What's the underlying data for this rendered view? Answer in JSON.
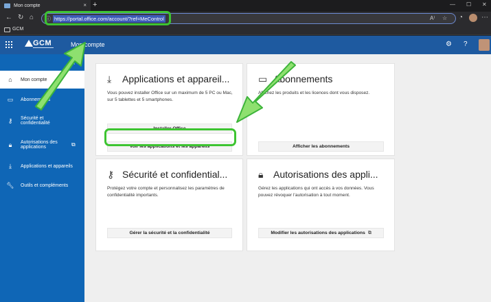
{
  "browser": {
    "tab_title": "Mon compte",
    "tab_close": "×",
    "new_tab": "+",
    "url": "https://portal.office.com/account/?ref=MeControl",
    "bookmark_label": "GCM"
  },
  "app": {
    "brand": "GCM",
    "title": "Mon compte"
  },
  "sidebar": {
    "items": [
      {
        "label": "Mon compte",
        "icon": "home-icon"
      },
      {
        "label": "Abonnements",
        "icon": "card-icon"
      },
      {
        "label": "Sécurité et confidentialité",
        "icon": "key-icon"
      },
      {
        "label": "Autorisations des applications",
        "icon": "lock-icon"
      },
      {
        "label": "Applications et appareils",
        "icon": "download-icon"
      },
      {
        "label": "Outils et compléments",
        "icon": "wrench-icon"
      }
    ]
  },
  "cards": {
    "apps": {
      "title": "Applications et appareil...",
      "desc": "Vous pouvez installer Office sur un maximum de 5 PC ou Mac, sur 5 tablettes et 5 smartphones.",
      "install_label": "Installer Office",
      "view_label": "Voir les applications et les appareils"
    },
    "subscriptions": {
      "title": "Abonnements",
      "desc": "Affichez les produits et les licences dont vous disposez.",
      "button_label": "Afficher les abonnements"
    },
    "security": {
      "title": "Sécurité et confidential...",
      "desc": "Protégez votre compte et personnalisez les paramètres de confidentialité importants.",
      "button_label": "Gérer la sécurité et la confidentialité"
    },
    "permissions": {
      "title": "Autorisations des appli...",
      "desc": "Gérez les applications qui ont accès à vos données. Vous pouvez révoquer l’autorisation à tout moment.",
      "button_label": "Modifier les autorisations des applications"
    }
  },
  "colors": {
    "sidebar": "#0f66b6",
    "appbar": "#1e5aa0",
    "highlight": "#3dc431"
  }
}
